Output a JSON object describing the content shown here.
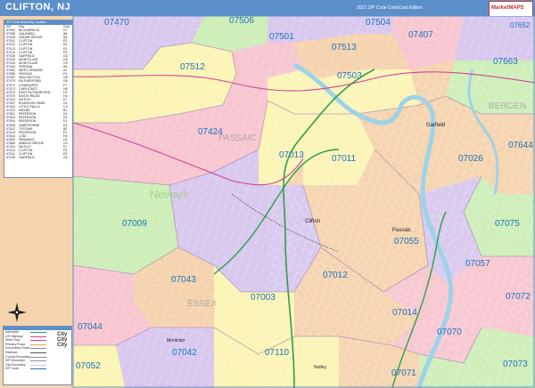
{
  "header": {
    "title": "CLIFTON, NJ",
    "edition": "2022 ZIP Code ColorCast Edition",
    "brand": "MarketMAPS"
  },
  "map": {
    "zip_labels": [
      "07470",
      "07506",
      "07504",
      "07407",
      "07501",
      "07513",
      "07512",
      "07503",
      "07663",
      "07424",
      "07013",
      "07011",
      "07026",
      "07644",
      "07009",
      "07055",
      "07075",
      "07043",
      "07012",
      "07057",
      "07003",
      "07072",
      "07014",
      "07044",
      "07042",
      "07110",
      "07070",
      "07052",
      "07071",
      "07073",
      "07652"
    ],
    "place_labels": [
      "PASSAIC",
      "BERGEN",
      "ESSEX",
      "Newark",
      "Clifton",
      "Passaic",
      "Garfield",
      "Montclair",
      "Nutley"
    ],
    "colors": {
      "pink": "#f7c6d0",
      "yellow": "#fbf4b5",
      "peach": "#f5d3ae",
      "lavender": "#d8c8ee",
      "green": "#cdeeb7",
      "blue_label": "#1e73be",
      "water": "#9dd3e8",
      "major_road": "#2e9e4a",
      "rail": "#d0439a"
    }
  },
  "zip_index": {
    "header": "ZIP Code Area/City Location",
    "columns": [
      "ZIP",
      "City",
      "Grid"
    ],
    "rows": [
      [
        "07003",
        "BLOOMFIELD",
        "D7"
      ],
      [
        "07006",
        "CALDWELL",
        "A6"
      ],
      [
        "07009",
        "CEDAR GROVE",
        "B4"
      ],
      [
        "07011",
        "CLIFTON",
        "E3"
      ],
      [
        "07012",
        "CLIFTON",
        "E5"
      ],
      [
        "07013",
        "CLIFTON",
        "E3"
      ],
      [
        "07014",
        "CLIFTON",
        "F5"
      ],
      [
        "07026",
        "GARFIELD",
        "G3"
      ],
      [
        "07042",
        "MONTCLAIR",
        "C6"
      ],
      [
        "07043",
        "MONTCLAIR",
        "C5"
      ],
      [
        "07044",
        "VERONA",
        "A6"
      ],
      [
        "07052",
        "WEST ORANGE",
        "A7"
      ],
      [
        "07055",
        "PASSAIC",
        "F4"
      ],
      [
        "07057",
        "WALLINGTON",
        "G5"
      ],
      [
        "07070",
        "RUTHERFORD",
        "G6"
      ],
      [
        "07071",
        "LYNDHURST",
        "F7"
      ],
      [
        "07072",
        "CARLSTADT",
        "H6"
      ],
      [
        "07073",
        "EAST RUTHERFORD",
        "H7"
      ],
      [
        "07075",
        "WOOD RIDGE",
        "H4"
      ],
      [
        "07110",
        "NUTLEY",
        "E7"
      ],
      [
        "07407",
        "ELMWOOD PARK",
        "G1"
      ],
      [
        "07424",
        "LITTLE FALLS",
        "C3"
      ],
      [
        "07470",
        "WAYNE",
        "B1"
      ],
      [
        "07501",
        "PATERSON",
        "D1"
      ],
      [
        "07503",
        "PATERSON",
        "E2"
      ],
      [
        "07504",
        "PATERSON",
        "E1"
      ],
      [
        "07506",
        "HAWTHORNE",
        "D1"
      ],
      [
        "07512",
        "TOTOWA",
        "B2"
      ],
      [
        "07513",
        "PATERSON",
        "E1"
      ],
      [
        "07644",
        "LODI",
        "H3"
      ],
      [
        "07652",
        "PARAMUS",
        "H1"
      ],
      [
        "07663",
        "SADDLE BROOK",
        "G2"
      ],
      [
        "07110",
        "NUTLEY",
        "E7"
      ],
      [
        "07014",
        "CLIFTON",
        "F5"
      ],
      [
        "07011",
        "CLIFTON",
        "E3"
      ],
      [
        "07026",
        "GARFIELD",
        "G3"
      ]
    ]
  },
  "legend": {
    "items": [
      "Interstate",
      "US Highway",
      "State Hwy",
      "Primary Road",
      "Secondary Road",
      "Railroad",
      "County Boundary",
      "ZIP Boundary",
      "City Boundary",
      "ZIP Code"
    ],
    "city_sample": "City\nCity\nCity"
  }
}
